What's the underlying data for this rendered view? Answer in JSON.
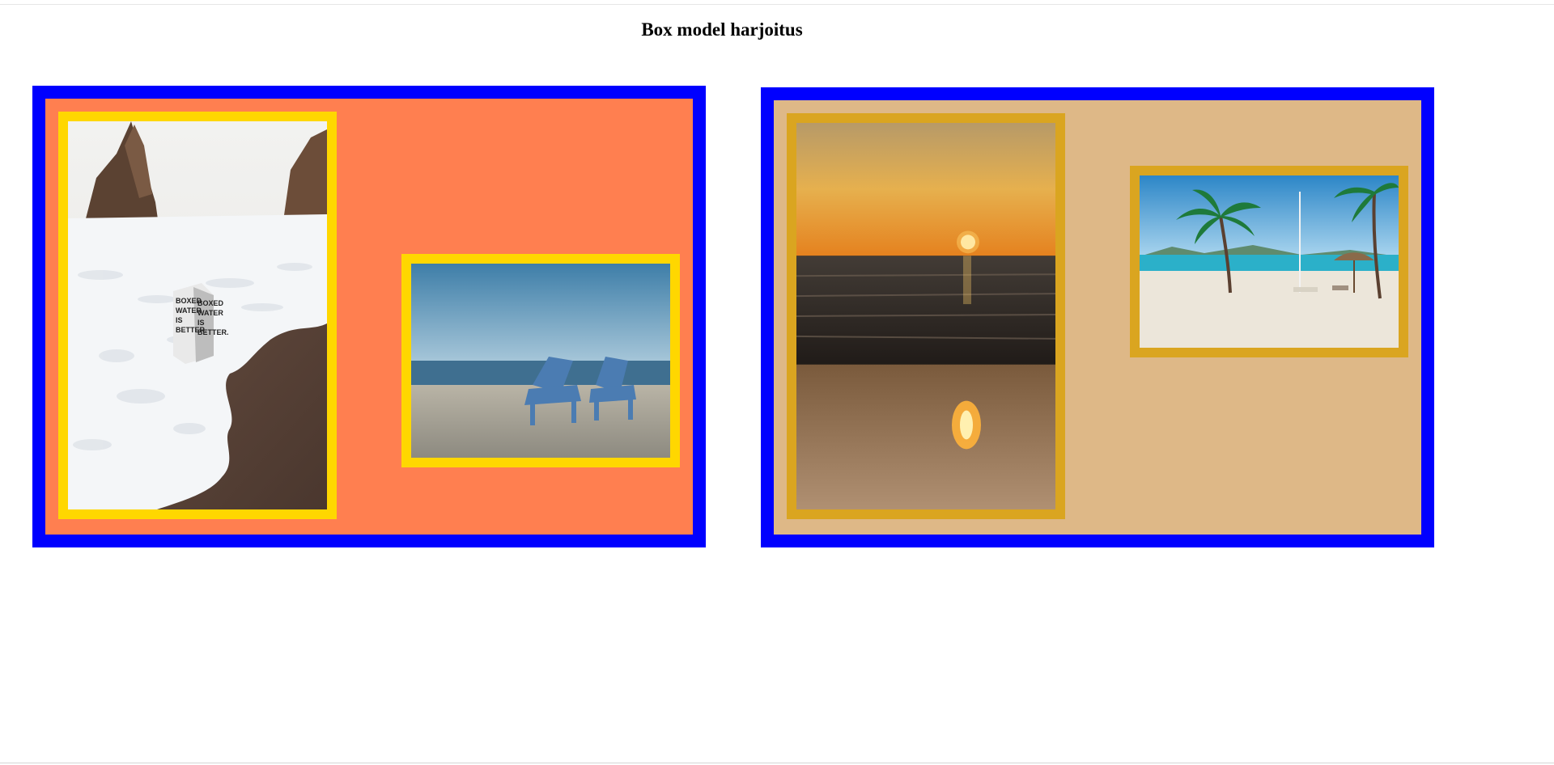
{
  "page": {
    "title": "Box model harjoitus"
  },
  "colors": {
    "box_border": "#0000ff",
    "box1_background": "#ff7f50",
    "box1_photo_border": "#ffd700",
    "box2_background": "#deb887",
    "box2_photo_border": "#daa520"
  },
  "boxes": [
    {
      "photos": [
        {
          "subject": "foam-beach-boxed-water"
        },
        {
          "subject": "two-blue-beach-chairs"
        }
      ]
    },
    {
      "photos": [
        {
          "subject": "sunset-over-sea"
        },
        {
          "subject": "tropical-palm-beach"
        }
      ]
    }
  ],
  "carton_text": "BOXED WATER IS BETTER."
}
